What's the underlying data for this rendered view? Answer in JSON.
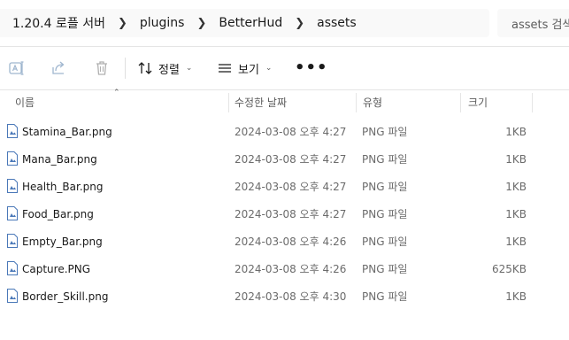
{
  "breadcrumb": [
    "1.20.4 로플 서버",
    "plugins",
    "BetterHud",
    "assets"
  ],
  "search": {
    "placeholder": "assets 검색"
  },
  "toolbar": {
    "icons": [
      "rename-icon",
      "share-icon",
      "delete-icon"
    ],
    "sort_label": "정렬",
    "view_label": "보기",
    "more_label": "•••"
  },
  "columns": {
    "name": "이름",
    "date": "수정한 날짜",
    "type": "유형",
    "size": "크기"
  },
  "files": [
    {
      "name": "Stamina_Bar.png",
      "date": "2024-03-08 오후 4:27",
      "type": "PNG 파일",
      "size": "1KB"
    },
    {
      "name": "Mana_Bar.png",
      "date": "2024-03-08 오후 4:27",
      "type": "PNG 파일",
      "size": "1KB"
    },
    {
      "name": "Health_Bar.png",
      "date": "2024-03-08 오후 4:27",
      "type": "PNG 파일",
      "size": "1KB"
    },
    {
      "name": "Food_Bar.png",
      "date": "2024-03-08 오후 4:27",
      "type": "PNG 파일",
      "size": "1KB"
    },
    {
      "name": "Empty_Bar.png",
      "date": "2024-03-08 오후 4:26",
      "type": "PNG 파일",
      "size": "1KB"
    },
    {
      "name": "Capture.PNG",
      "date": "2024-03-08 오후 4:26",
      "type": "PNG 파일",
      "size": "625KB"
    },
    {
      "name": "Border_Skill.png",
      "date": "2024-03-08 오후 4:30",
      "type": "PNG 파일",
      "size": "1KB"
    }
  ]
}
